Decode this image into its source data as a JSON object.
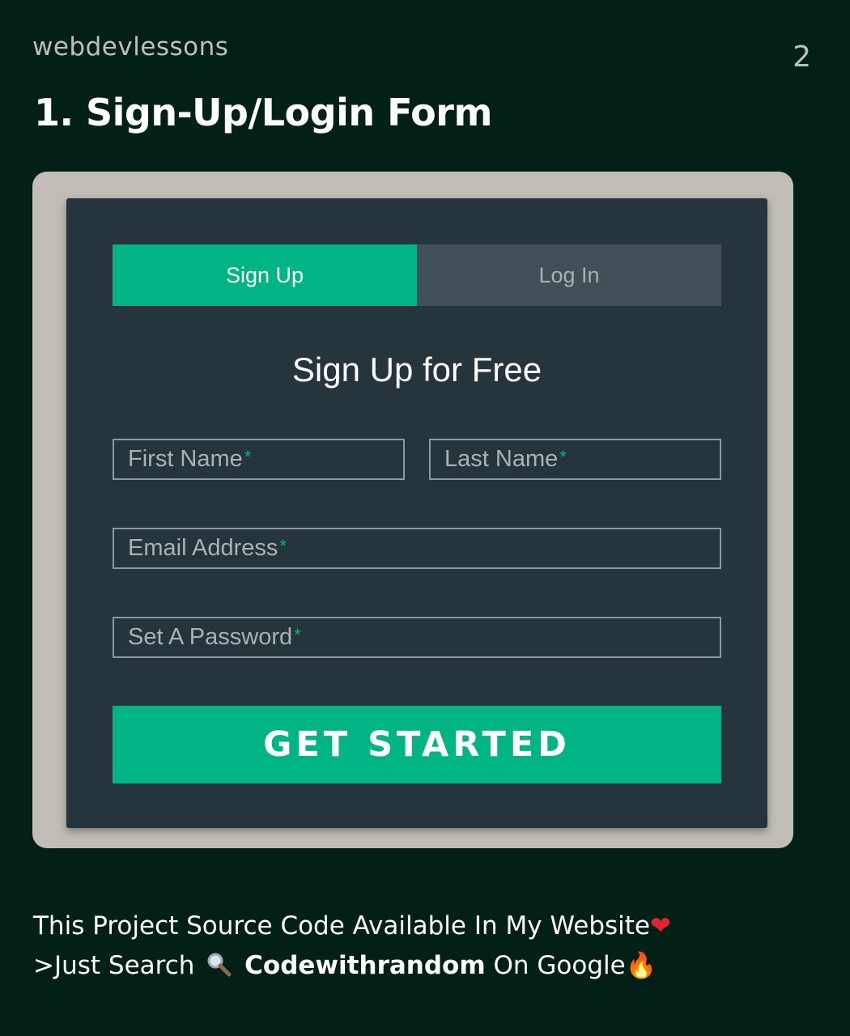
{
  "header": {
    "brand": "webdevlessons",
    "page_number": "2",
    "title": "1. Sign-Up/Login Form"
  },
  "form": {
    "tabs": [
      {
        "label": "Sign Up",
        "active": true
      },
      {
        "label": "Log In",
        "active": false
      }
    ],
    "title": "Sign Up for Free",
    "fields": {
      "first_name": {
        "placeholder": "First Name",
        "required_mark": "*"
      },
      "last_name": {
        "placeholder": "Last Name",
        "required_mark": "*"
      },
      "email": {
        "placeholder": "Email Address",
        "required_mark": "*"
      },
      "password": {
        "placeholder": "Set A Password",
        "required_mark": "*"
      }
    },
    "submit_label": "GET STARTED",
    "accent_color": "#00b483",
    "card_color": "#26353b"
  },
  "caption": {
    "line1": "This Project Source Code Available In My Website",
    "line1_emoji": "❤",
    "line2_prefix": ">Just Search",
    "line2_brand": "Codewithrandom",
    "line2_suffix": "On Google",
    "line2_emoji": "🔥",
    "icons": [
      "heart-icon",
      "magnifier-icon",
      "fire-icon"
    ]
  },
  "colors": {
    "background": "#022016",
    "frame": "#c2bcb6"
  }
}
